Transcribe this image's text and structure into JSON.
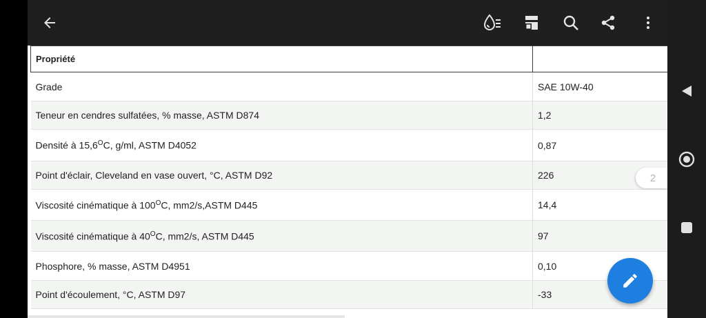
{
  "toolbar": {
    "icons": [
      "back-arrow-icon",
      "drop-list-icon",
      "document-icon",
      "search-icon",
      "share-icon",
      "more-vert-icon"
    ]
  },
  "table": {
    "header": [
      "Propriété",
      ""
    ],
    "rows": [
      {
        "property": "Grade",
        "value": "SAE 10W-40"
      },
      {
        "property": "Teneur en cendres sulfatées, % masse, ASTM D874",
        "value": "1,2"
      },
      {
        "property_pre": "Densité à 15,6",
        "property_sup": "O",
        "property_post": "C, g/ml, ASTM D4052",
        "value": "0,87"
      },
      {
        "property": "Point d'éclair, Cleveland en vase ouvert, °C, ASTM D92",
        "value": "226"
      },
      {
        "property_pre": "Viscosité cinématique à 100",
        "property_sup": "O",
        "property_post": "C, mm2/s,ASTM D445",
        "value": "14,4"
      },
      {
        "property_pre": "Viscosité cinématique à 40",
        "property_sup": "O",
        "property_post": "C, mm2/s, ASTM D445",
        "value": "97"
      },
      {
        "property": "Phosphore, % masse, ASTM D4951",
        "value": "0,10"
      },
      {
        "property": "Point d'écoulement, °C, ASTM D97",
        "value": "-33"
      }
    ]
  },
  "page_indicator": "2",
  "fab": {
    "icon": "pencil-icon"
  },
  "colors": {
    "toolbar": "#1f1f1f",
    "accent": "#1f7fe0",
    "row_alt": "#f3f5f3"
  }
}
